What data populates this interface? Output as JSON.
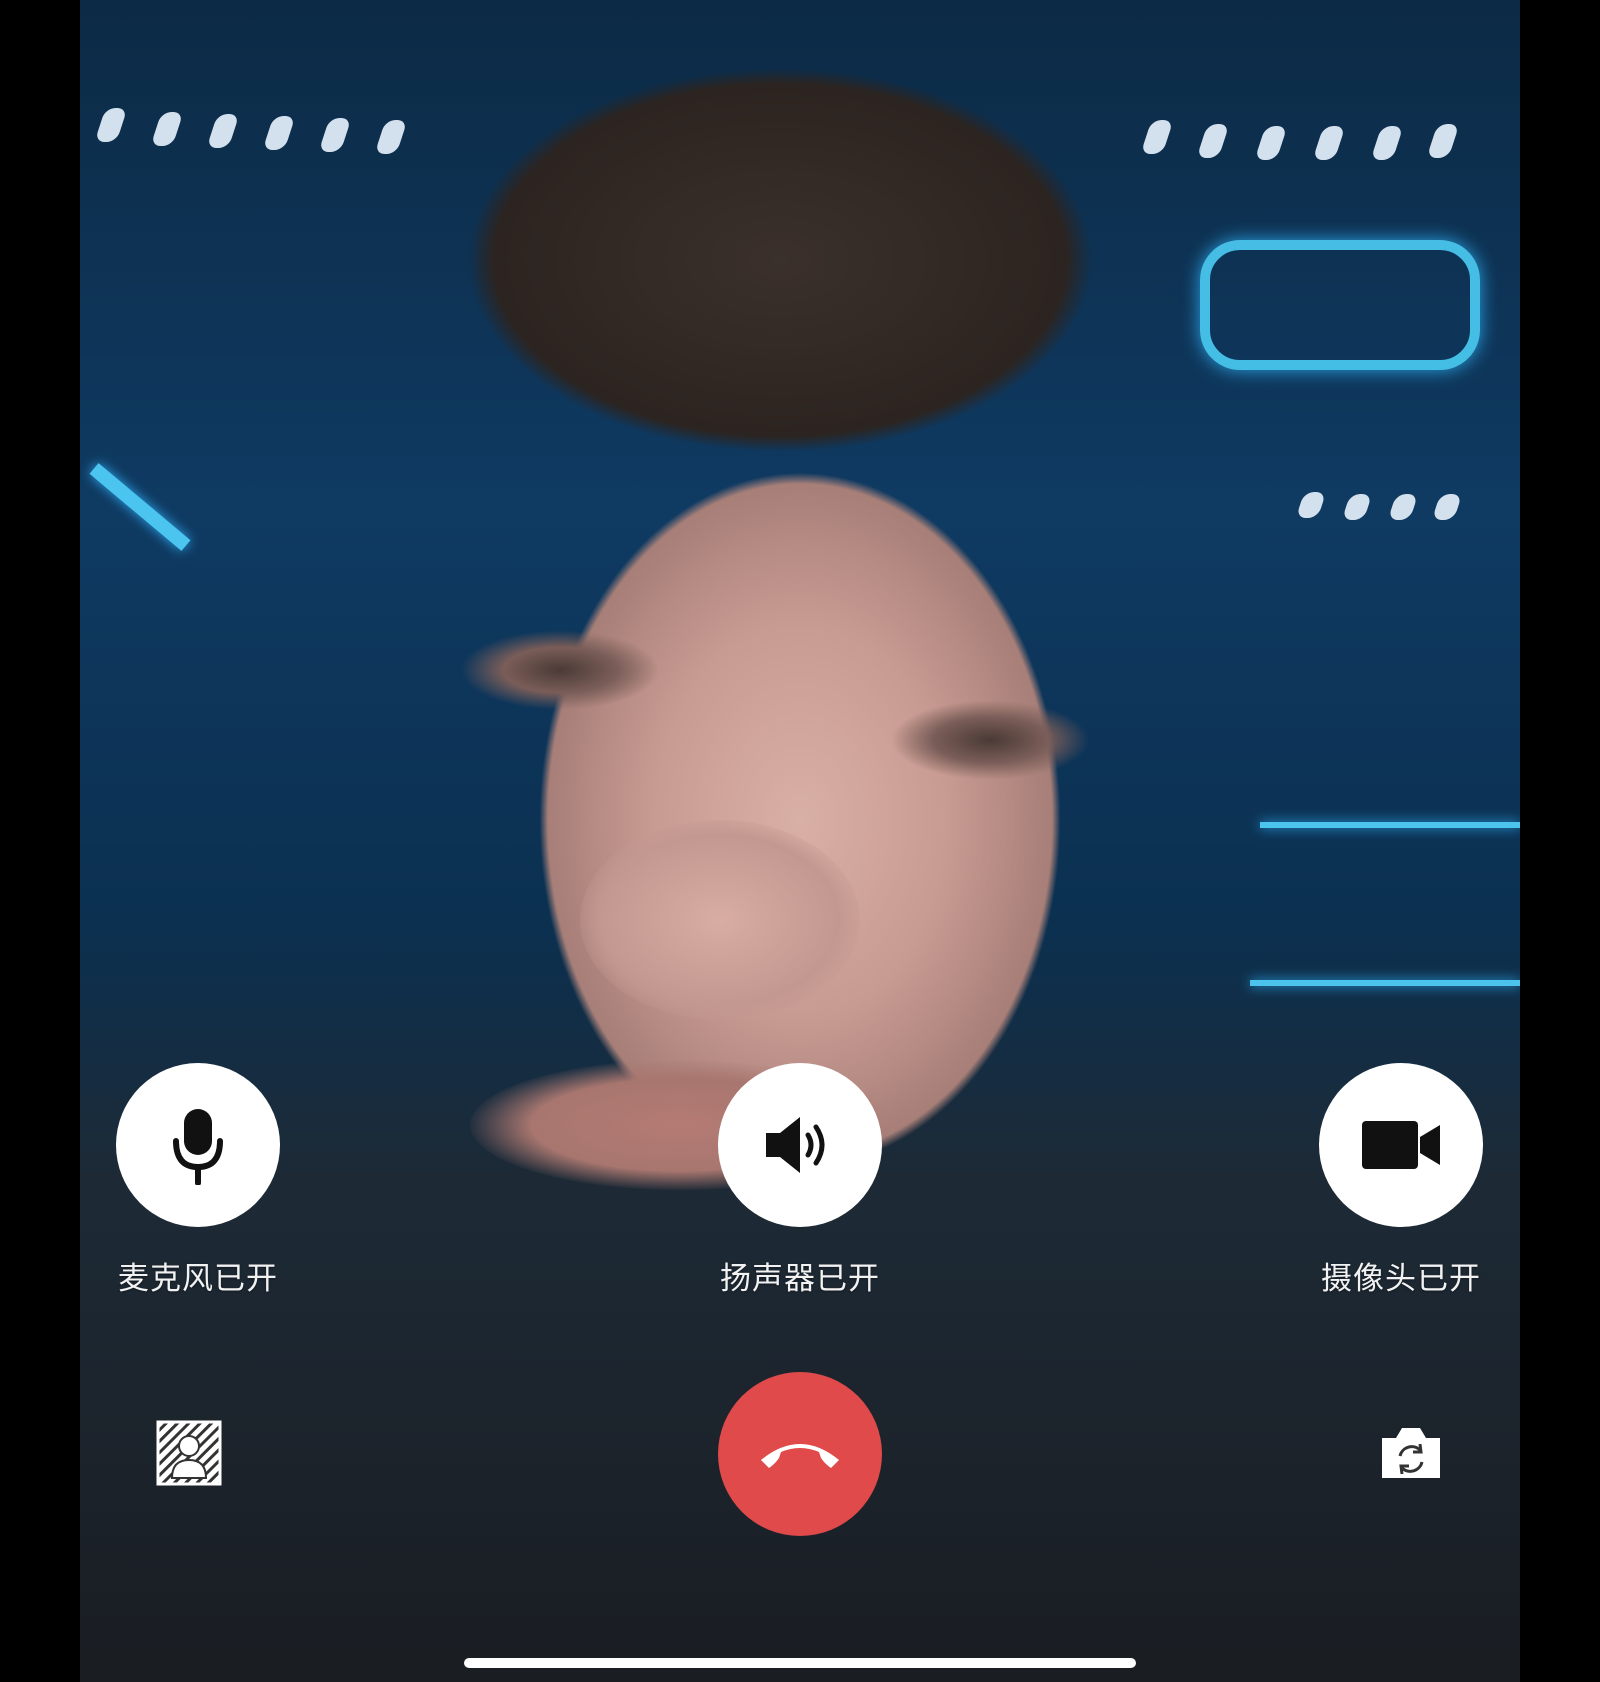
{
  "call": {
    "controls": {
      "microphone": {
        "label": "麦克风已开",
        "icon": "microphone-icon",
        "state": "on"
      },
      "speaker": {
        "label": "扬声器已开",
        "icon": "speaker-icon",
        "state": "on"
      },
      "camera": {
        "label": "摄像头已开",
        "icon": "video-camera-icon",
        "state": "on"
      }
    },
    "hangup": {
      "icon": "phone-hangup-icon",
      "color": "#e04a4a"
    },
    "blur_background": {
      "icon": "background-blur-icon"
    },
    "switch_camera": {
      "icon": "camera-switch-icon"
    }
  },
  "colors": {
    "button_background": "#ffffff",
    "hangup": "#e04a4a",
    "label_text": "#f2f2f2"
  }
}
